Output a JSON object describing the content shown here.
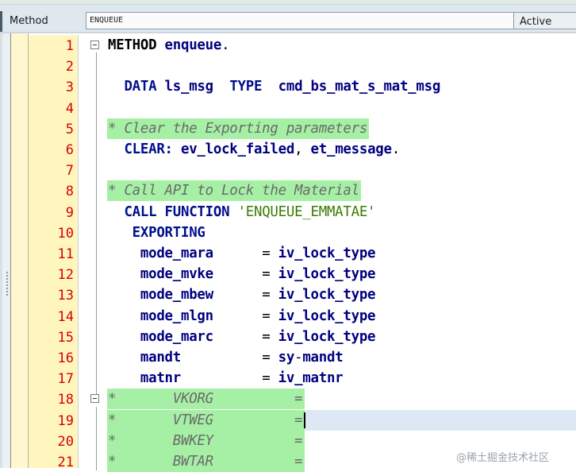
{
  "header": {
    "type_label": "Method",
    "method_name": "ENQUEUE",
    "status": "Active"
  },
  "editor": {
    "lines": [
      {
        "num": "1",
        "fold": true,
        "tokens": [
          {
            "t": "METHOD ",
            "c": "kw-dark"
          },
          {
            "t": "enqueue",
            "c": "id"
          },
          {
            "t": ".",
            "c": "op"
          }
        ]
      },
      {
        "num": "2",
        "fold": false,
        "tokens": []
      },
      {
        "num": "3",
        "fold": false,
        "tokens": [
          {
            "t": "  DATA ",
            "c": "kw"
          },
          {
            "t": "ls_msg  ",
            "c": "id"
          },
          {
            "t": "TYPE  ",
            "c": "kw"
          },
          {
            "t": "cmd_bs_mat_s_mat_msg",
            "c": "id"
          }
        ]
      },
      {
        "num": "4",
        "fold": false,
        "tokens": []
      },
      {
        "num": "5",
        "fold": false,
        "comment": true,
        "tokens": [
          {
            "t": "* Clear the Exporting parameters",
            "c": "cmt"
          }
        ]
      },
      {
        "num": "6",
        "fold": false,
        "tokens": [
          {
            "t": "  CLEAR: ",
            "c": "kw"
          },
          {
            "t": "ev_lock_failed",
            "c": "id"
          },
          {
            "t": ", ",
            "c": "op"
          },
          {
            "t": "et_message",
            "c": "id"
          },
          {
            "t": ".",
            "c": "op"
          }
        ]
      },
      {
        "num": "7",
        "fold": false,
        "tokens": []
      },
      {
        "num": "8",
        "fold": false,
        "comment": true,
        "tokens": [
          {
            "t": "* Call API to Lock the Material",
            "c": "cmt"
          }
        ]
      },
      {
        "num": "9",
        "fold": false,
        "tokens": [
          {
            "t": "  CALL FUNCTION ",
            "c": "kw"
          },
          {
            "t": "'ENQUEUE_EMMATAE'",
            "c": "str"
          }
        ]
      },
      {
        "num": "10",
        "fold": false,
        "tokens": [
          {
            "t": "   EXPORTING",
            "c": "kw"
          }
        ]
      },
      {
        "num": "11",
        "fold": false,
        "tokens": [
          {
            "t": "    mode_mara      ",
            "c": "id"
          },
          {
            "t": "= ",
            "c": "op"
          },
          {
            "t": "iv_lock_type",
            "c": "id"
          }
        ]
      },
      {
        "num": "12",
        "fold": false,
        "tokens": [
          {
            "t": "    mode_mvke      ",
            "c": "id"
          },
          {
            "t": "= ",
            "c": "op"
          },
          {
            "t": "iv_lock_type",
            "c": "id"
          }
        ]
      },
      {
        "num": "13",
        "fold": false,
        "tokens": [
          {
            "t": "    mode_mbew      ",
            "c": "id"
          },
          {
            "t": "= ",
            "c": "op"
          },
          {
            "t": "iv_lock_type",
            "c": "id"
          }
        ]
      },
      {
        "num": "14",
        "fold": false,
        "tokens": [
          {
            "t": "    mode_mlgn      ",
            "c": "id"
          },
          {
            "t": "= ",
            "c": "op"
          },
          {
            "t": "iv_lock_type",
            "c": "id"
          }
        ]
      },
      {
        "num": "15",
        "fold": false,
        "tokens": [
          {
            "t": "    mode_marc      ",
            "c": "id"
          },
          {
            "t": "= ",
            "c": "op"
          },
          {
            "t": "iv_lock_type",
            "c": "id"
          }
        ]
      },
      {
        "num": "16",
        "fold": false,
        "tokens": [
          {
            "t": "    mandt          ",
            "c": "id"
          },
          {
            "t": "= ",
            "c": "op"
          },
          {
            "t": "sy",
            "c": "id"
          },
          {
            "t": "-",
            "c": "op"
          },
          {
            "t": "mandt",
            "c": "id"
          }
        ]
      },
      {
        "num": "17",
        "fold": false,
        "tokens": [
          {
            "t": "    matnr          ",
            "c": "id"
          },
          {
            "t": "= ",
            "c": "op"
          },
          {
            "t": "iv_matnr",
            "c": "id"
          }
        ]
      },
      {
        "num": "18",
        "fold": true,
        "comment": true,
        "tokens": [
          {
            "t": "*       VKORG          =",
            "c": "cmt"
          }
        ]
      },
      {
        "num": "19",
        "fold": false,
        "comment": true,
        "current": true,
        "tokens": [
          {
            "t": "*       VTWEG          =",
            "c": "cmt"
          }
        ]
      },
      {
        "num": "20",
        "fold": false,
        "comment": true,
        "tokens": [
          {
            "t": "*       BWKEY          =",
            "c": "cmt"
          }
        ]
      },
      {
        "num": "21",
        "fold": false,
        "comment": true,
        "tokens": [
          {
            "t": "*       BWTAR          =",
            "c": "cmt"
          }
        ]
      }
    ]
  },
  "watermark": "@稀土掘金技术社区",
  "colors": {
    "comment_bg": "#a6f0a6",
    "current_line_bg": "#dde8f4",
    "line_number": "#d80000",
    "keyword": "#000f8c",
    "string": "#3a7c00"
  }
}
